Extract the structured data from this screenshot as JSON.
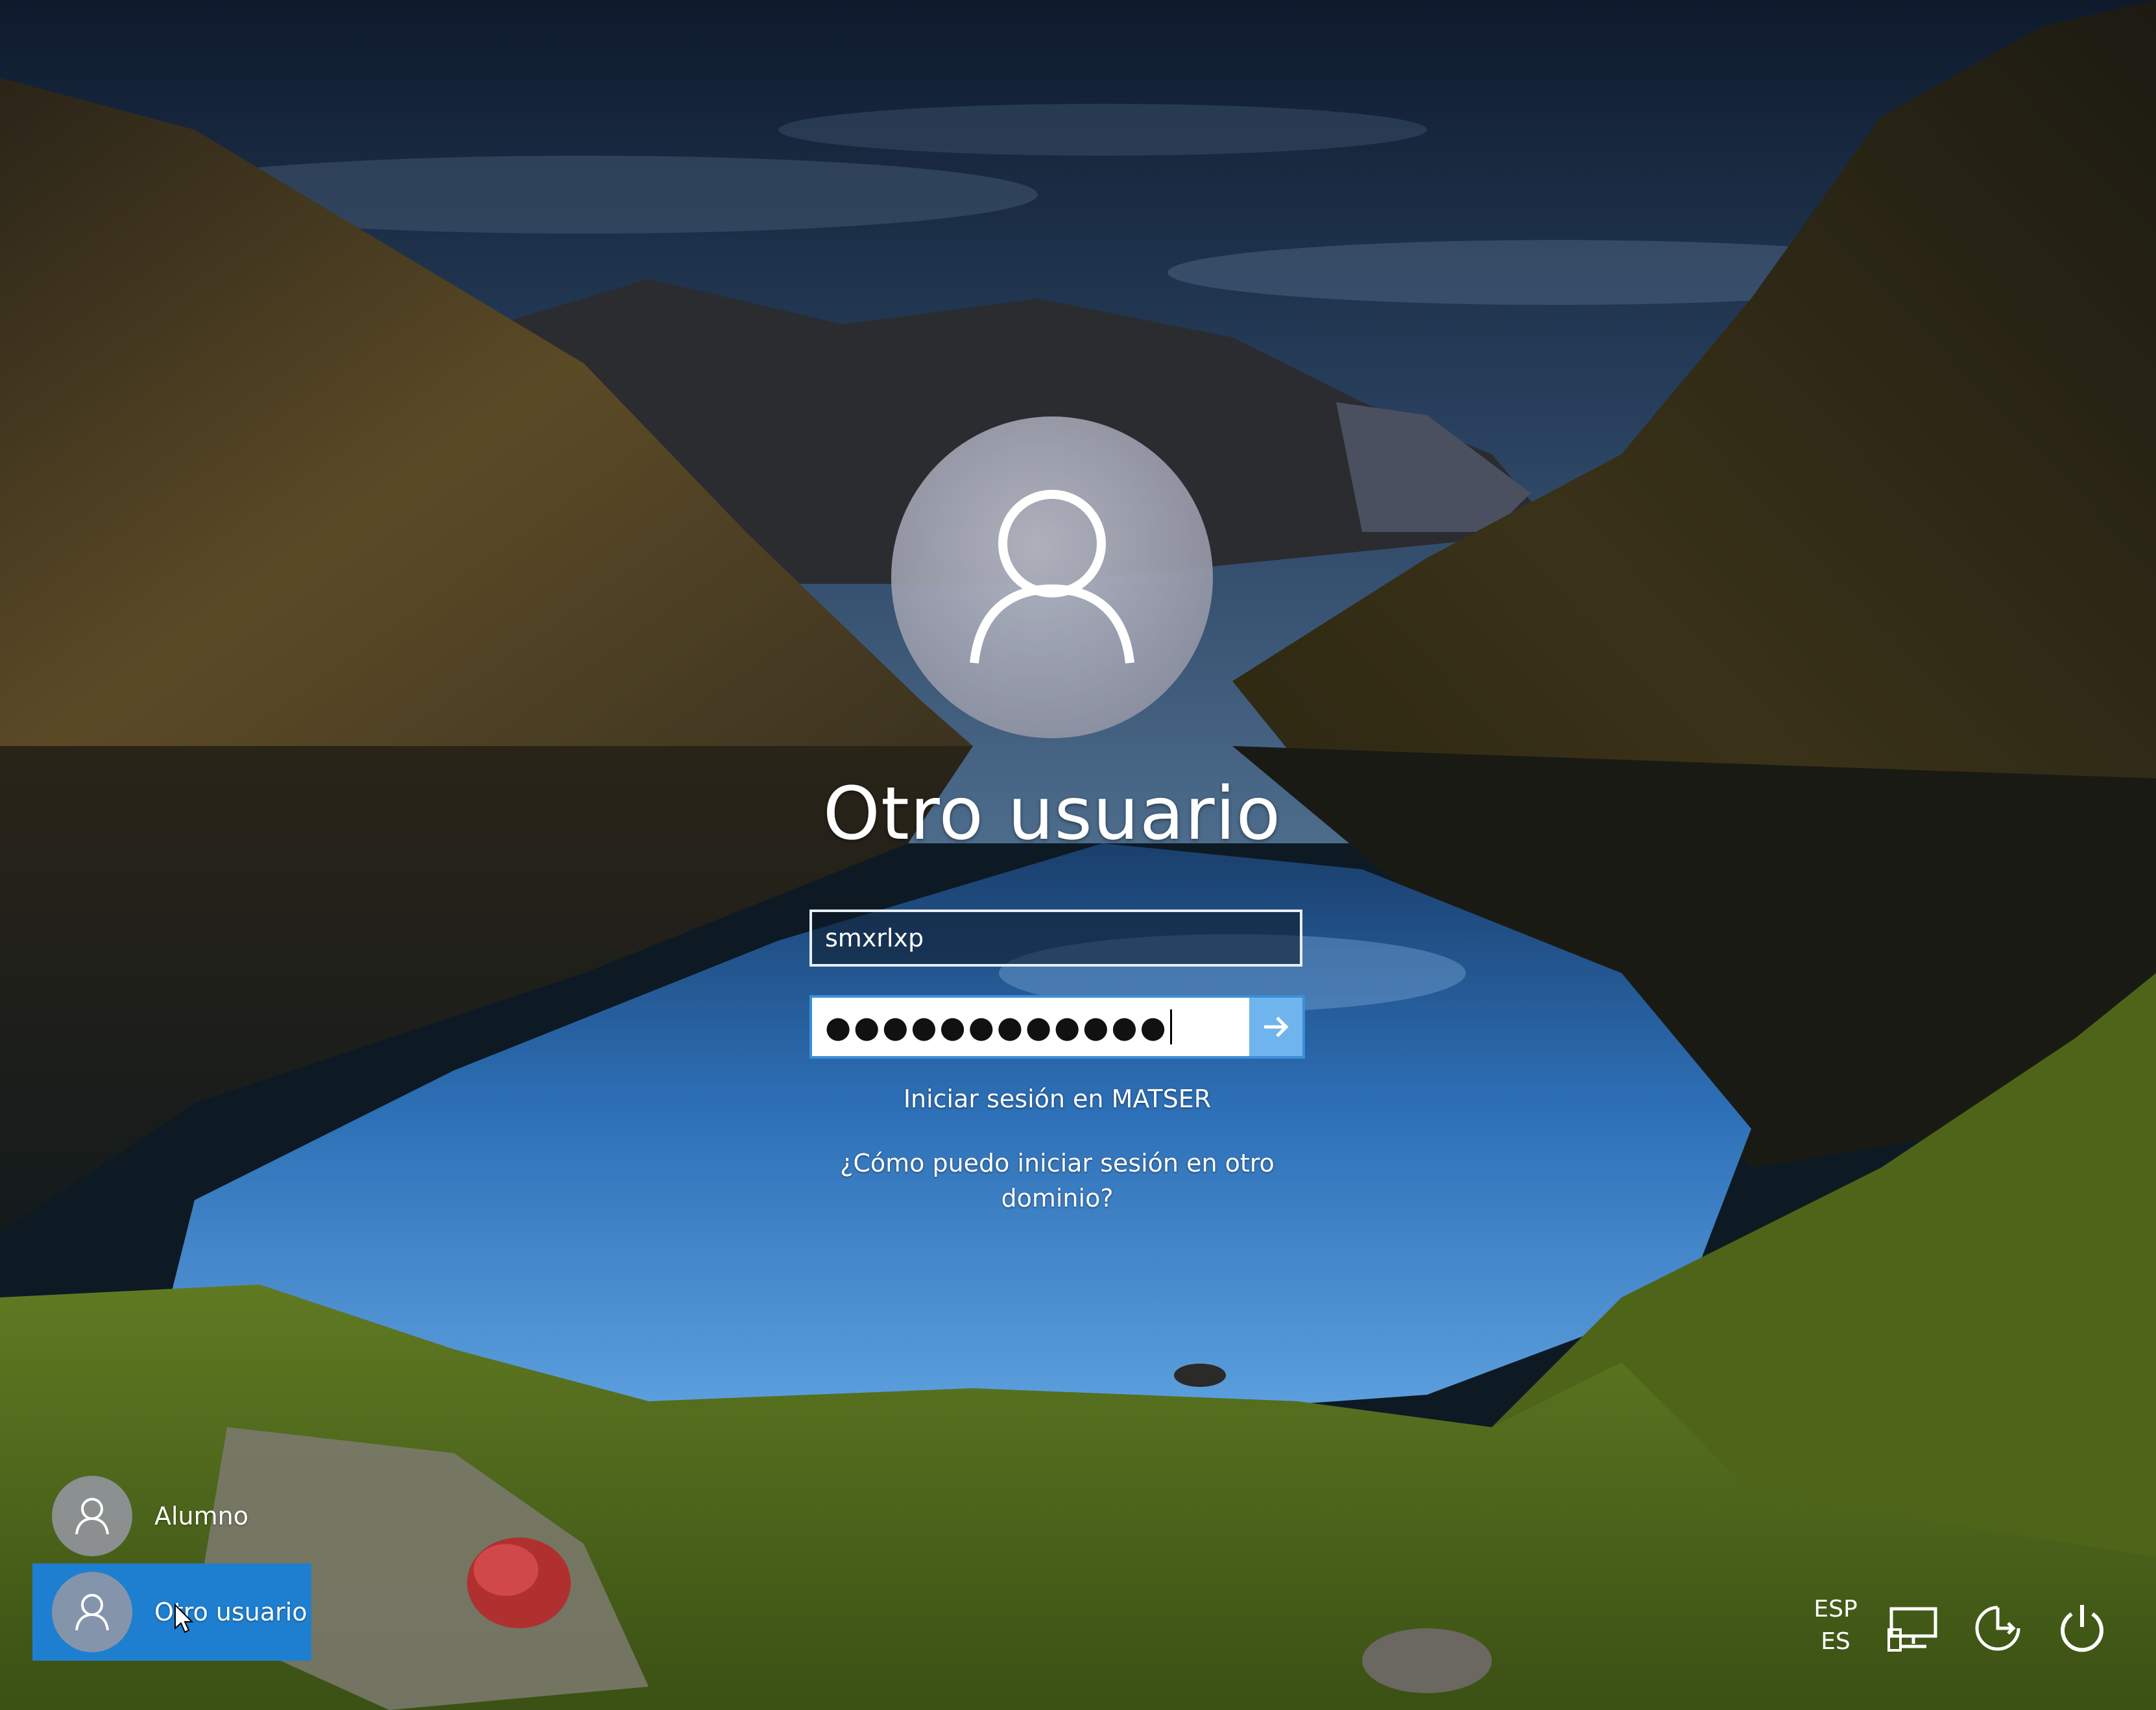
{
  "login": {
    "user_title": "Otro usuario",
    "username_value": "smxrlxp",
    "password_mask": "●●●●●●●●●●●●",
    "signin_domain_text": "Iniciar sesión en MATSER",
    "other_domain_link_text": "¿Cómo puedo iniciar sesión en otro dominio?"
  },
  "users": [
    {
      "name": "Alumno",
      "selected": false
    },
    {
      "name": "Otro usuario",
      "selected": true
    }
  ],
  "tray": {
    "lang_top": "ESP",
    "lang_bottom": "ES",
    "icons": [
      "network-icon",
      "accessibility-icon",
      "power-icon"
    ]
  },
  "colors": {
    "selected_user_bg": "#1e7fd0",
    "submit_button_bg": "#6fb4ec",
    "field_focus_border": "#3a8fd8"
  }
}
